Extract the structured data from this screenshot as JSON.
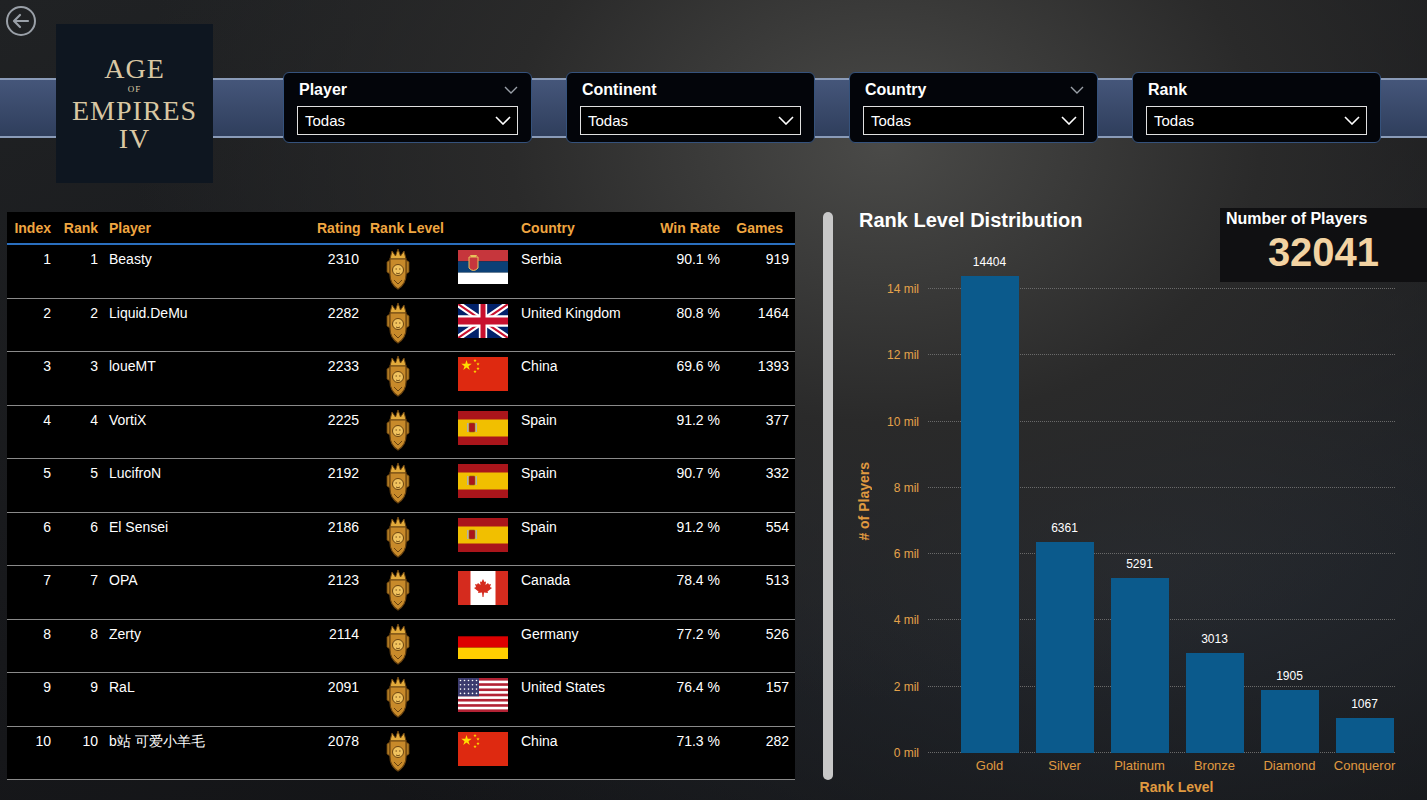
{
  "logo": {
    "lines": [
      {
        "text": "AGE",
        "kind": "large"
      },
      {
        "text": "OF",
        "kind": "small"
      },
      {
        "text": "EMPIRES",
        "kind": "large"
      },
      {
        "text": "IV",
        "kind": "large"
      }
    ]
  },
  "filters": [
    {
      "label": "Player",
      "value": "Todas",
      "expand_icon": true
    },
    {
      "label": "Continent",
      "value": "Todas",
      "expand_icon": false
    },
    {
      "label": "Country",
      "value": "Todas",
      "expand_icon": true
    },
    {
      "label": "Rank",
      "value": "Todas",
      "expand_icon": false
    }
  ],
  "table": {
    "columns": [
      "Index",
      "Rank",
      "Player",
      "Rating",
      "Rank Level",
      "Country",
      "Win Rate",
      "Games"
    ],
    "rows": [
      {
        "index": "1",
        "rank": "1",
        "player": "Beasty",
        "rating": "2310",
        "flag": "rs",
        "country": "Serbia",
        "win_rate": "90.1 %",
        "games": "919"
      },
      {
        "index": "2",
        "rank": "2",
        "player": "Liquid.DeMu",
        "rating": "2282",
        "flag": "gb",
        "country": "United Kingdom",
        "win_rate": "80.8 %",
        "games": "1464"
      },
      {
        "index": "3",
        "rank": "3",
        "player": "loueMT",
        "rating": "2233",
        "flag": "cn",
        "country": "China",
        "win_rate": "69.6 %",
        "games": "1393"
      },
      {
        "index": "4",
        "rank": "4",
        "player": "VortiX",
        "rating": "2225",
        "flag": "es",
        "country": "Spain",
        "win_rate": "91.2 %",
        "games": "377"
      },
      {
        "index": "5",
        "rank": "5",
        "player": "LucifroN",
        "rating": "2192",
        "flag": "es",
        "country": "Spain",
        "win_rate": "90.7 %",
        "games": "332"
      },
      {
        "index": "6",
        "rank": "6",
        "player": "El Sensei",
        "rating": "2186",
        "flag": "es",
        "country": "Spain",
        "win_rate": "91.2 %",
        "games": "554"
      },
      {
        "index": "7",
        "rank": "7",
        "player": "OPA",
        "rating": "2123",
        "flag": "ca",
        "country": "Canada",
        "win_rate": "78.4 %",
        "games": "513"
      },
      {
        "index": "8",
        "rank": "8",
        "player": "Zerty",
        "rating": "2114",
        "flag": "de",
        "country": "Germany",
        "win_rate": "77.2 %",
        "games": "526"
      },
      {
        "index": "9",
        "rank": "9",
        "player": "RaL",
        "rating": "2091",
        "flag": "us",
        "country": "United States",
        "win_rate": "76.4 %",
        "games": "157"
      },
      {
        "index": "10",
        "rank": "10",
        "player": "b站 可爱小羊毛",
        "rating": "2078",
        "flag": "cn",
        "country": "China",
        "win_rate": "71.3 %",
        "games": "282"
      }
    ],
    "scrollbar": {
      "level": 1
    }
  },
  "chart": {
    "title": "Rank Level Distribution",
    "y_axis": {
      "title": "# of Players",
      "ticks": [
        {
          "label": "14 mil",
          "value": 14000
        },
        {
          "label": "12 mil",
          "value": 12000
        },
        {
          "label": "10 mil",
          "value": 10000
        },
        {
          "label": "8 mil",
          "value": 8000
        },
        {
          "label": "6 mil",
          "value": 6000
        },
        {
          "label": "4 mil",
          "value": 4000
        },
        {
          "label": "2 mil",
          "value": 2000
        },
        {
          "label": "0 mil",
          "value": 0
        }
      ]
    },
    "x_axis": {
      "title": "Rank Level"
    },
    "categories": [
      "Gold",
      "Silver",
      "Platinum",
      "Bronze",
      "Diamond",
      "Conqueror"
    ],
    "series": [
      {
        "values": [
          14404,
          6361,
          5291,
          3013,
          1905,
          1067
        ],
        "labels": [
          "14404",
          "6361",
          "5291",
          "3013",
          "1905",
          "1067"
        ]
      }
    ]
  },
  "kpi": {
    "title": "Number of Players",
    "value": "32041"
  }
}
